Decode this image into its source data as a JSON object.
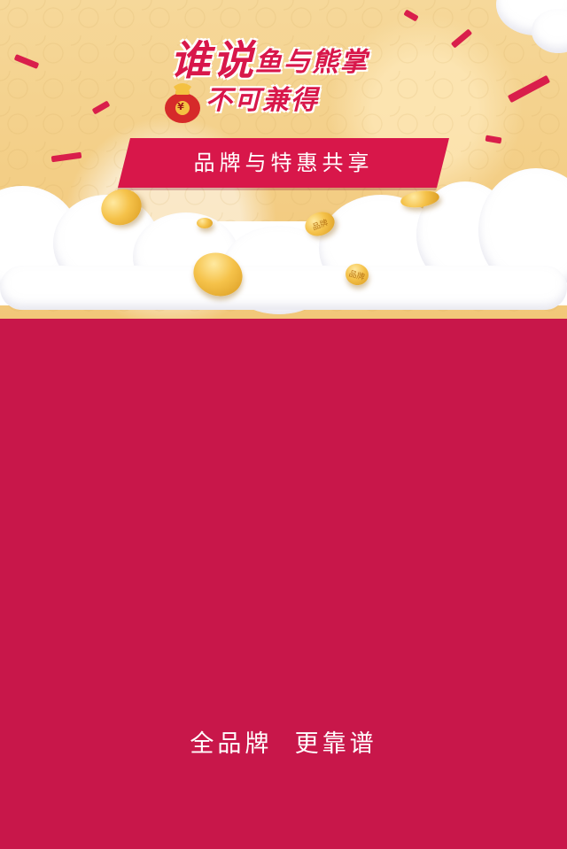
{
  "hero": {
    "title_line1_big": "谁说",
    "title_line1_small": "鱼与熊掌",
    "title_line2": "不可兼得",
    "moneybag_symbol": "¥"
  },
  "banner": {
    "text": "品牌与特惠共享"
  },
  "coins": {
    "mark_text": "品牌"
  },
  "footer": {
    "slogan": "全品牌  更靠谱"
  },
  "colors": {
    "brand_red": "#c8174a",
    "banner_red": "#d8174a",
    "sky_gold": "#f3ce86"
  }
}
